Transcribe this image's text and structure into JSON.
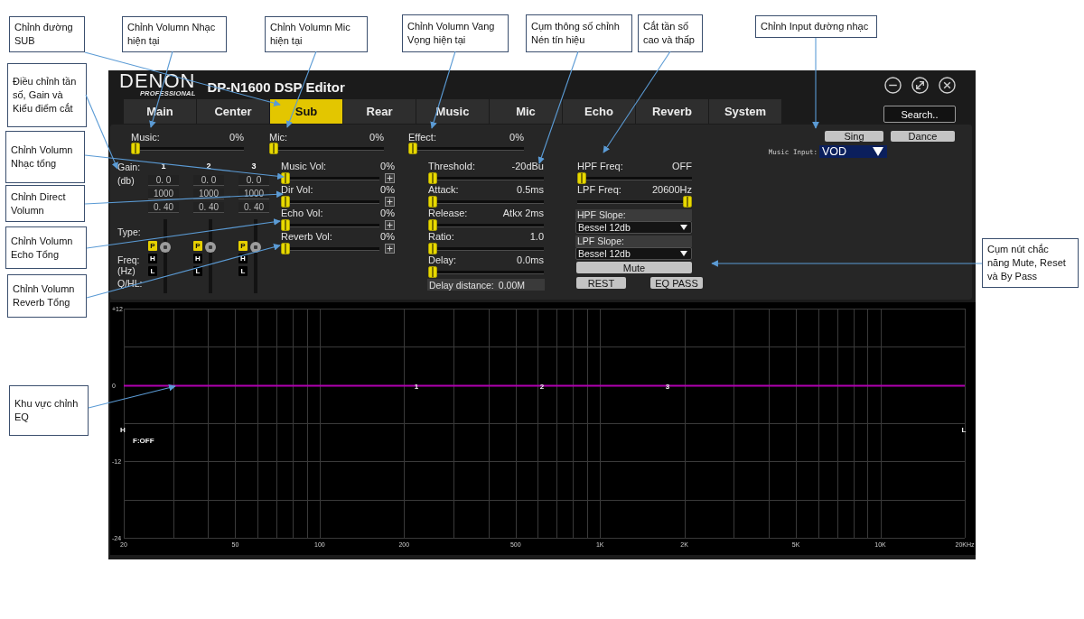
{
  "callouts": [
    {
      "text": "Chỉnh đường SUB"
    },
    {
      "text": "Chỉnh Volumn Nhạc hiện tại"
    },
    {
      "text": "Chỉnh Volumn Mic hiện tại"
    },
    {
      "text": "Chỉnh Volumn Vang Vọng hiện tại"
    },
    {
      "text": "Cụm thông số chỉnh Nén tín hiệu"
    },
    {
      "text": "Cắt tần số cao và thấp"
    },
    {
      "text": "Chỉnh Input đường nhạc"
    },
    {
      "text": "Điều chỉnh tần số, Gain và Kiểu điểm cắt"
    },
    {
      "text": "Chỉnh Volumn Nhạc tổng"
    },
    {
      "text": "Chỉnh Direct Volumn"
    },
    {
      "text": "Chỉnh Volumn Echo Tổng"
    },
    {
      "text": "Chỉnh Volumn Reverb Tổng"
    },
    {
      "text": "Cụm nút chắc năng Mute, Reset và By Pass"
    },
    {
      "text": "Khu vực chỉnh EQ"
    }
  ],
  "window": {
    "logo": "DENON",
    "logo_subtitle": "PROFESSIONAL",
    "title": "DP-N1600 DSP Editor"
  },
  "tabs": [
    {
      "label": "Main",
      "selected": false
    },
    {
      "label": "Center",
      "selected": false
    },
    {
      "label": "Sub",
      "selected": true
    },
    {
      "label": "Rear",
      "selected": false
    },
    {
      "label": "Music",
      "selected": false
    },
    {
      "label": "Mic",
      "selected": false
    },
    {
      "label": "Echo",
      "selected": false
    },
    {
      "label": "Reverb",
      "selected": false
    },
    {
      "label": "System",
      "selected": false
    }
  ],
  "search_button": "Search..",
  "main_sliders": [
    {
      "label": "Music:",
      "reading": "0%",
      "level": 0
    },
    {
      "label": "Mic:",
      "reading": "0%",
      "level": 0
    },
    {
      "label": "Effect:",
      "reading": "0%",
      "level": 0
    }
  ],
  "mode_buttons": [
    "Sing",
    "Dance"
  ],
  "music_input": {
    "label": "Music Input:",
    "value": "VOD"
  },
  "eq_bands": {
    "gain_label": "Gain:",
    "gain_unit": "(db)",
    "type_label": "Type:",
    "freq_label": "Freq:",
    "freq_unit": "(Hz)",
    "q_label": "Q/HL:",
    "bands": [
      {
        "number": "1",
        "gain": "0. 0",
        "frequency": "1000",
        "q": "0. 40",
        "level": 0.64,
        "types": [
          {
            "label": "P",
            "selected": true
          },
          {
            "label": "H",
            "selected": false
          },
          {
            "label": "L",
            "selected": false
          }
        ]
      },
      {
        "number": "2",
        "gain": "0. 0",
        "frequency": "1000",
        "q": "0. 40",
        "level": 0.64,
        "types": [
          {
            "label": "P",
            "selected": true
          },
          {
            "label": "H",
            "selected": false
          },
          {
            "label": "L",
            "selected": false
          }
        ]
      },
      {
        "number": "3",
        "gain": "0. 0",
        "frequency": "1000",
        "q": "0. 40",
        "level": 0.64,
        "types": [
          {
            "label": "P",
            "selected": true
          },
          {
            "label": "H",
            "selected": false
          },
          {
            "label": "L",
            "selected": false
          }
        ]
      }
    ]
  },
  "volumes": [
    {
      "label": "Music Vol:",
      "reading": "0%",
      "level": 0
    },
    {
      "label": "Dir Vol:",
      "reading": "0%",
      "level": 0
    },
    {
      "label": "Echo Vol:",
      "reading": "0%",
      "level": 0
    },
    {
      "label": "Reverb Vol:",
      "reading": "0%",
      "level": 0
    }
  ],
  "compressor": {
    "params": [
      {
        "label": "Threshold:",
        "reading": "-20dBu",
        "level": 0
      },
      {
        "label": "Attack:",
        "reading": "0.5ms",
        "level": 0
      },
      {
        "label": "Release:",
        "reading": "Atkx 2ms",
        "level": 0
      },
      {
        "label": "Ratio:",
        "reading": "1.0",
        "level": 0
      },
      {
        "label": "Delay:",
        "reading": "0.0ms",
        "level": 0
      }
    ],
    "delay_distance": {
      "label": "Delay distance:",
      "value": "0.00M"
    }
  },
  "filters": {
    "sliders": [
      {
        "label": "HPF Freq:",
        "reading": "OFF",
        "level": 0
      },
      {
        "label": "LPF Freq:",
        "reading": "20600Hz",
        "level": 1
      }
    ],
    "slopes": [
      {
        "label": "HPF Slope:",
        "value": "Bessel 12db"
      },
      {
        "label": "LPF Slope:",
        "value": "Bessel 12db"
      }
    ],
    "mute_button": "Mute",
    "reset_button": "REST",
    "bypass_button": "EQ PASS"
  },
  "eq_graph": {
    "y_axis_labels": [
      "+12",
      "0",
      "-12",
      "-24"
    ],
    "x_axis_labels": [
      "20",
      "50",
      "100",
      "200",
      "500",
      "1K",
      "2K",
      "5K",
      "10K",
      "20KHz"
    ],
    "band_markers": [
      "1",
      "2",
      "3"
    ],
    "left_marker": "H",
    "right_marker": "L",
    "filter_status": "F:OFF"
  }
}
